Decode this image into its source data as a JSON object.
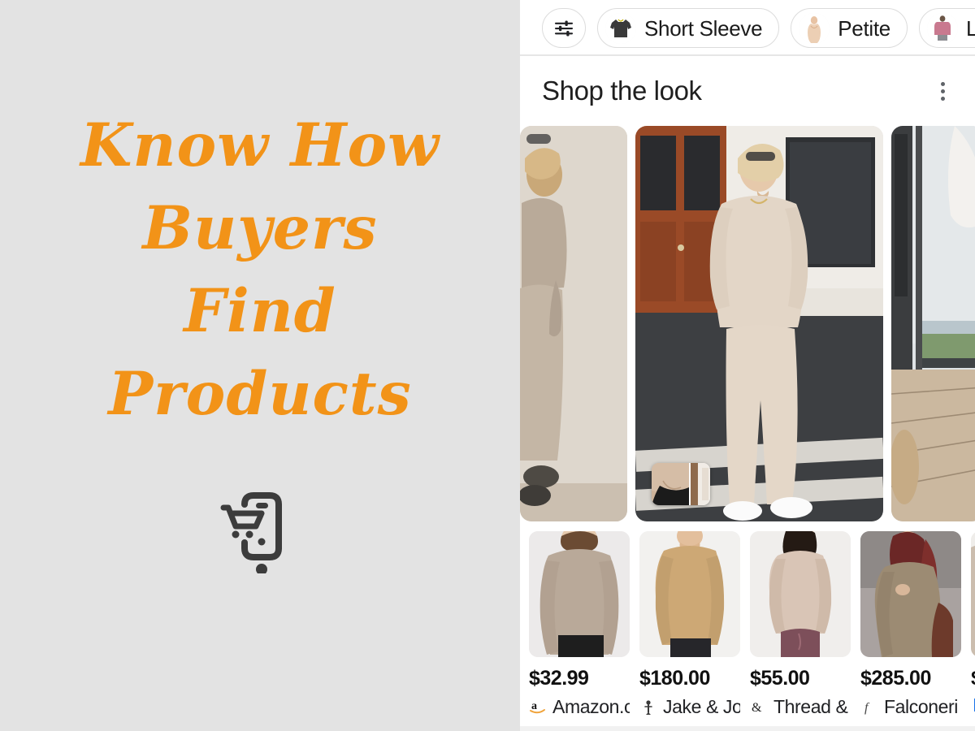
{
  "promo": {
    "headline_lines": [
      "Know How",
      "Buyers",
      "Find",
      "Products"
    ],
    "accent_color": "#f29318",
    "background_color": "#e3e3e3",
    "icon_name": "mobile-shopping-cart-icon",
    "icon_color": "#3c3c3c"
  },
  "app": {
    "filter_bar": {
      "filter_button_icon": "tune-sliders-icon",
      "chips": [
        {
          "label": "Short Sleeve",
          "thumb_name": "short-sleeve-tee-thumb"
        },
        {
          "label": "Petite",
          "thumb_name": "petite-model-thumb"
        },
        {
          "label": "Long Sleeve",
          "thumb_name": "long-sleeve-top-thumb",
          "truncated": true
        }
      ]
    },
    "section": {
      "title": "Shop the look",
      "overflow_icon": "three-dot-vertical-icon"
    },
    "look_carousel": {
      "cards": [
        {
          "name": "look-card-previous",
          "alt": "Model in beige knit set against wall"
        },
        {
          "name": "look-card-main",
          "alt": "Blonde model in cream lounge set on crosswalk"
        },
        {
          "name": "look-card-next",
          "alt": "Outdoor deck with ocean view"
        }
      ],
      "thumb_tag_name": "look-detail-thumbnail"
    },
    "products": [
      {
        "price": "$32.99",
        "merchant": "Amazon.c",
        "merchant_icon": "amazon-logo-icon",
        "photo_alt": "Taupe oversized sweatshirt on model"
      },
      {
        "price": "$180.00",
        "merchant": "Jake & Jo",
        "merchant_icon": "jake-and-jones-icon",
        "photo_alt": "Tan long sleeve tee on male model"
      },
      {
        "price": "$55.00",
        "merchant": "Thread & :",
        "merchant_icon": "thread-supply-icon",
        "photo_alt": "Blush pullover with mauve shorts"
      },
      {
        "price": "$285.00",
        "merchant": "Falconeri",
        "merchant_icon": "falconeri-icon",
        "photo_alt": "Camel cashmere set on seated model"
      },
      {
        "price": "$",
        "merchant": "",
        "merchant_icon": "blue-merchant-icon",
        "photo_alt": "Partially visible fifth product"
      }
    ]
  }
}
